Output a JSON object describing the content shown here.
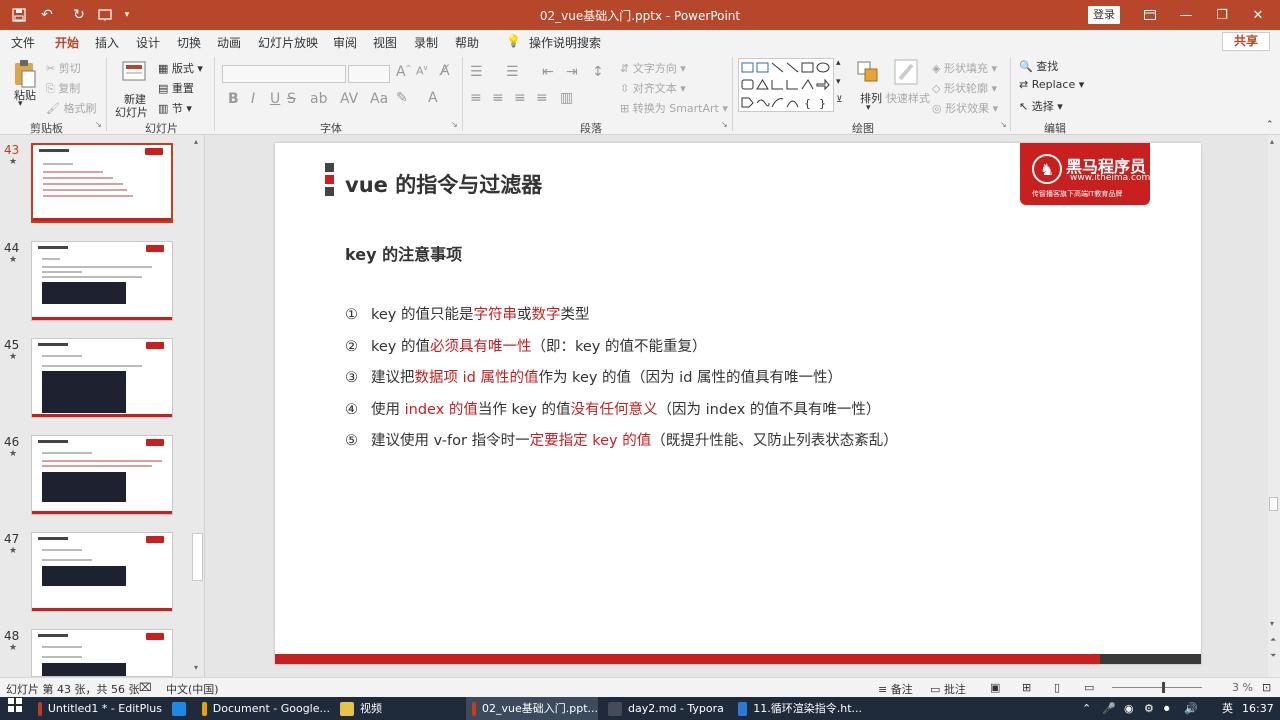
{
  "window": {
    "title": "02_vue基础入门.pptx - PowerPoint",
    "login_label": "登录",
    "qa_icons": [
      "save-icon",
      "undo-icon",
      "redo-icon",
      "present-icon",
      "customize-icon"
    ],
    "controls": [
      "minimize-icon",
      "restore-icon",
      "close-icon",
      "ribbon-display-icon"
    ]
  },
  "tabs": [
    "文件",
    "开始",
    "插入",
    "设计",
    "切换",
    "动画",
    "幻灯片放映",
    "审阅",
    "视图",
    "录制",
    "帮助"
  ],
  "tell_me": "操作说明搜索",
  "share_label": "共享",
  "ribbon": {
    "clipboard": {
      "paste": "粘贴",
      "cut": "剪切",
      "copy": "复制",
      "format_painter": "格式刷",
      "label": "剪贴板"
    },
    "slides": {
      "new_slide_1": "新建",
      "new_slide_2": "幻灯片",
      "layout": "版式",
      "reset": "重置",
      "section": "节",
      "label": "幻灯片"
    },
    "font": {
      "label": "字体",
      "buttons": [
        "B",
        "I",
        "U",
        "S"
      ]
    },
    "paragraph": {
      "text_direction": "文字方向",
      "align_text": "对齐文本",
      "smartart": "转换为 SmartArt",
      "label": "段落"
    },
    "drawing": {
      "arrange": "排列",
      "quick_styles": "快速样式",
      "shape_fill": "形状填充",
      "shape_outline": "形状轮廓",
      "shape_effects": "形状效果",
      "label": "绘图"
    },
    "editing": {
      "find": "查找",
      "replace": "Replace",
      "select": "选择",
      "label": "编辑"
    }
  },
  "thumbnails": [
    {
      "num": "43",
      "selected": true
    },
    {
      "num": "44",
      "selected": false
    },
    {
      "num": "45",
      "selected": false
    },
    {
      "num": "46",
      "selected": false
    },
    {
      "num": "47",
      "selected": false
    },
    {
      "num": "48",
      "selected": false
    }
  ],
  "slide": {
    "title": "vue 的指令与过滤器",
    "logo_text": "黑马程序员",
    "logo_url": "www.itheima.com",
    "logo_tagline": "传智播客旗下高端IT教育品牌",
    "subtitle": "key 的注意事项",
    "bullets": [
      {
        "num": "①",
        "parts": [
          {
            "t": "key 的值只能是",
            "red": false
          },
          {
            "t": "字符串",
            "red": true
          },
          {
            "t": "或",
            "red": false
          },
          {
            "t": "数字",
            "red": true
          },
          {
            "t": "类型",
            "red": false
          }
        ]
      },
      {
        "num": "②",
        "parts": [
          {
            "t": "key 的值",
            "red": false
          },
          {
            "t": "必须具有唯一性",
            "red": true
          },
          {
            "t": "（即：key 的值不能重复）",
            "red": false
          }
        ]
      },
      {
        "num": "③",
        "parts": [
          {
            "t": "建议把",
            "red": false
          },
          {
            "t": "数据项 id 属性的值",
            "red": true
          },
          {
            "t": "作为 key 的值（因为 id 属性的值具有唯一性）",
            "red": false
          }
        ]
      },
      {
        "num": "④",
        "parts": [
          {
            "t": "使用 ",
            "red": false
          },
          {
            "t": "index 的值",
            "red": true
          },
          {
            "t": "当作 key 的值",
            "red": false
          },
          {
            "t": "没有任何意义",
            "red": true
          },
          {
            "t": "（因为 index 的值不具有唯一性）",
            "red": false
          }
        ]
      },
      {
        "num": "⑤",
        "parts": [
          {
            "t": "建议使用 v-for 指令时一",
            "red": false
          },
          {
            "t": "定要指定 key 的值",
            "red": true
          },
          {
            "t": "（既提升性能、又防止列表状态紊乱）",
            "red": false
          }
        ]
      }
    ]
  },
  "status": {
    "slide_count": "幻灯片 第 43 张，共 56 张",
    "language": "中文(中国)",
    "notes": "备注",
    "comments": "批注",
    "zoom": "3 %"
  },
  "taskbar": {
    "items": [
      {
        "label": "Untitled1 * - EditPlus",
        "color": "#c0392b",
        "active": false
      },
      {
        "label": "",
        "color": "#1e88e5",
        "active": false
      },
      {
        "label": "Document - Google...",
        "color": "#e8a10a",
        "active": false
      },
      {
        "label": "视频",
        "color": "#e6c34a",
        "active": false
      },
      {
        "label": "02_vue基础入门.ppt...",
        "color": "#c43e1c",
        "active": true
      },
      {
        "label": "day2.md - Typora",
        "color": "#444c5c",
        "active": false
      },
      {
        "label": "11.循环渲染指令.ht...",
        "color": "#2b7bd6",
        "active": false
      }
    ],
    "ime": "英",
    "time": "16:37"
  },
  "colors": {
    "accent": "#b7472a",
    "brand_red": "#c8201f"
  }
}
